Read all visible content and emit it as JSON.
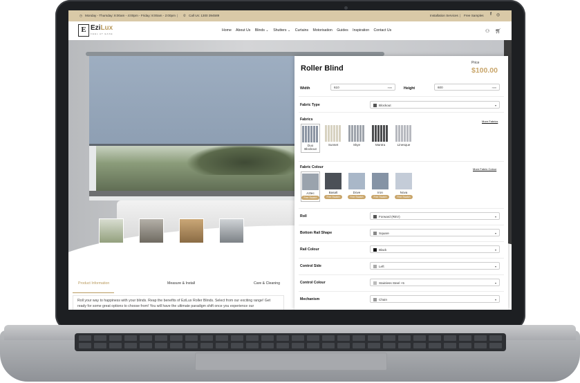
{
  "topbar": {
    "hours": "Monday - Thursday: 8:00am - 4:00pm - Friday: 8:00am - 2:00pm",
    "call": "Call Us: 1300 394589",
    "links": [
      "Installation Services",
      "Free Samples"
    ]
  },
  "logo": {
    "word_a": "Ezi",
    "word_b": "Lux",
    "tagline": "FEEL AT EASE",
    "mark": "E"
  },
  "menu": [
    "Home",
    "About Us",
    "Blinds",
    "Shutters",
    "Curtains",
    "Motorisation",
    "Guides",
    "Inspiration",
    "Contact Us"
  ],
  "product": {
    "title": "Roller Blind",
    "price_label": "Price",
    "price": "$100.00",
    "width_label": "Width",
    "width_value": "610",
    "height_label": "Height",
    "height_value": "600",
    "unit": "mm",
    "fabric_type_label": "Fabric Type",
    "fabric_type_value": "Blockout",
    "fabrics_label": "Fabrics",
    "more_fabrics": "More Fabrics",
    "fabrics": [
      {
        "name": "Duo Blockout",
        "color": "#8c95a3"
      },
      {
        "name": "Sunset",
        "color": "#d7d2c1"
      },
      {
        "name": "Skye",
        "color": "#9ea3ab"
      },
      {
        "name": "Mantra",
        "color": "#4b4c4e"
      },
      {
        "name": "Linesque",
        "color": "#b7b9bf"
      }
    ],
    "fabric_colour_label": "Fabric Colour",
    "more_fabric_colour": "More Fabric Colour",
    "free_swatch": "Free Swatch",
    "colours": [
      {
        "name": "Aztec",
        "color": "#9aa3ad"
      },
      {
        "name": "Basalt",
        "color": "#4b5057"
      },
      {
        "name": "Dove",
        "color": "#a9b7c8"
      },
      {
        "name": "Iron",
        "color": "#8593a5"
      },
      {
        "name": "Nova",
        "color": "#c4ccd8"
      }
    ],
    "options": [
      {
        "label": "Roll",
        "value": "Forward (REV)",
        "swatch": "#555555"
      },
      {
        "label": "Bottom Rail Shape",
        "value": "Square",
        "swatch": "#888888"
      },
      {
        "label": "Rail Colour",
        "value": "Black",
        "swatch": "#111111"
      },
      {
        "label": "Control Side",
        "value": "Left",
        "swatch": "#aaaaaa"
      },
      {
        "label": "Control Colour",
        "value": "Stainless Steel +5",
        "swatch": "#bbbbbb"
      },
      {
        "label": "Mechanism",
        "value": "Chain",
        "swatch": "#999999"
      }
    ]
  },
  "tabs": [
    "Product Information",
    "Measure & Install",
    "Care & Cleaning"
  ],
  "description": "Roll your way to happiness with your blinds. Reap the benefits of EziLux Roller Blinds. Select from our exciting range! Get ready for some great options to choose from! You will have the ultimate paradigm shift once you experience our"
}
